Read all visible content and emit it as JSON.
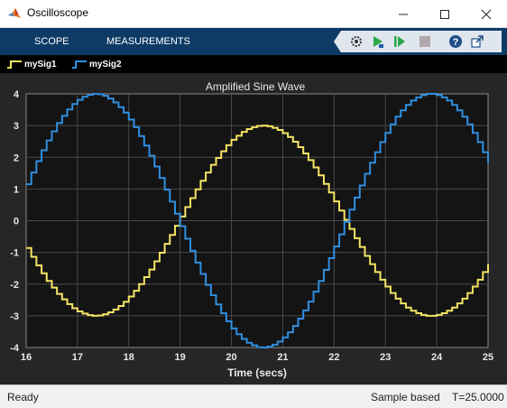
{
  "window": {
    "title": "Oscilloscope"
  },
  "toolstrip": {
    "tabs": [
      {
        "label": "SCOPE"
      },
      {
        "label": "MEASUREMENTS"
      }
    ],
    "icons": [
      "settings-icon",
      "step-forward-icon",
      "run-icon",
      "stop-icon",
      "help-icon",
      "undock-icon"
    ]
  },
  "legend": [
    {
      "label": "mySig1",
      "color": "#f5e463"
    },
    {
      "label": "mySig2",
      "color": "#2f8fe0"
    }
  ],
  "status": {
    "left": "Ready",
    "mode": "Sample based",
    "time": "T=25.0000"
  },
  "chart_data": {
    "type": "line",
    "title": "Amplified Sine Wave",
    "xlabel": "Time (secs)",
    "ylabel": "",
    "xlim": [
      16,
      25
    ],
    "ylim": [
      -4,
      4
    ],
    "xticks": [
      16,
      17,
      18,
      19,
      20,
      21,
      22,
      23,
      24,
      25
    ],
    "yticks": [
      4,
      3,
      2,
      1,
      0,
      -1,
      -2,
      -3,
      -4
    ],
    "grid": true,
    "legend_position": "top-left",
    "step": 0.1,
    "series": [
      {
        "name": "mySig1",
        "color": "#f5e463",
        "x": [
          16.0,
          16.1,
          16.2,
          16.3,
          16.4,
          16.5,
          16.6,
          16.7,
          16.8,
          16.9,
          17.0,
          17.1,
          17.2,
          17.3,
          17.4,
          17.5,
          17.6,
          17.7,
          17.8,
          17.9,
          18.0,
          18.1,
          18.2,
          18.3,
          18.4,
          18.5,
          18.6,
          18.7,
          18.8,
          18.9,
          19.0,
          19.1,
          19.2,
          19.3,
          19.4,
          19.5,
          19.6,
          19.7,
          19.8,
          19.9,
          20.0,
          20.1,
          20.2,
          20.3,
          20.4,
          20.5,
          20.6,
          20.7,
          20.8,
          20.9,
          21.0,
          21.1,
          21.2,
          21.3,
          21.4,
          21.5,
          21.6,
          21.7,
          21.8,
          21.9,
          22.0,
          22.1,
          22.2,
          22.3,
          22.4,
          22.5,
          22.6,
          22.7,
          22.8,
          22.9,
          23.0,
          23.1,
          23.2,
          23.3,
          23.4,
          23.5,
          23.6,
          23.7,
          23.8,
          23.9,
          24.0,
          24.1,
          24.2,
          24.3,
          24.4,
          24.5,
          24.6,
          24.7,
          24.8,
          24.9,
          25.0
        ],
        "y": [
          -0.86,
          -1.14,
          -1.41,
          -1.66,
          -1.9,
          -2.11,
          -2.31,
          -2.48,
          -2.63,
          -2.76,
          -2.86,
          -2.93,
          -2.98,
          -3.0,
          -2.99,
          -2.95,
          -2.89,
          -2.8,
          -2.69,
          -2.56,
          -2.39,
          -2.21,
          -2.0,
          -1.78,
          -1.54,
          -1.28,
          -1.01,
          -0.73,
          -0.45,
          -0.16,
          0.13,
          0.43,
          0.71,
          0.99,
          1.26,
          1.52,
          1.76,
          1.98,
          2.19,
          2.38,
          2.55,
          2.68,
          2.8,
          2.89,
          2.95,
          2.99,
          3.0,
          2.98,
          2.93,
          2.86,
          2.76,
          2.64,
          2.49,
          2.32,
          2.12,
          1.91,
          1.68,
          1.43,
          1.16,
          0.89,
          0.61,
          0.32,
          0.03,
          -0.26,
          -0.55,
          -0.83,
          -1.11,
          -1.37,
          -1.62,
          -1.86,
          -2.08,
          -2.28,
          -2.46,
          -2.61,
          -2.74,
          -2.84,
          -2.92,
          -2.97,
          -3.0,
          -3.0,
          -2.97,
          -2.92,
          -2.84,
          -2.74,
          -2.61,
          -2.46,
          -2.28,
          -2.08,
          -1.86,
          -1.62,
          -1.37
        ]
      },
      {
        "name": "mySig2",
        "color": "#2f8fe0",
        "x": [
          16.0,
          16.1,
          16.2,
          16.3,
          16.4,
          16.5,
          16.6,
          16.7,
          16.8,
          16.9,
          17.0,
          17.1,
          17.2,
          17.3,
          17.4,
          17.5,
          17.6,
          17.7,
          17.8,
          17.9,
          18.0,
          18.1,
          18.2,
          18.3,
          18.4,
          18.5,
          18.6,
          18.7,
          18.8,
          18.9,
          19.0,
          19.1,
          19.2,
          19.3,
          19.4,
          19.5,
          19.6,
          19.7,
          19.8,
          19.9,
          20.0,
          20.1,
          20.2,
          20.3,
          20.4,
          20.5,
          20.6,
          20.7,
          20.8,
          20.9,
          21.0,
          21.1,
          21.2,
          21.3,
          21.4,
          21.5,
          21.6,
          21.7,
          21.8,
          21.9,
          22.0,
          22.1,
          22.2,
          22.3,
          22.4,
          22.5,
          22.6,
          22.7,
          22.8,
          22.9,
          23.0,
          23.1,
          23.2,
          23.3,
          23.4,
          23.5,
          23.6,
          23.7,
          23.8,
          23.9,
          24.0,
          24.1,
          24.2,
          24.3,
          24.4,
          24.5,
          24.6,
          24.7,
          24.8,
          24.9,
          25.0
        ],
        "y": [
          1.15,
          1.52,
          1.88,
          2.22,
          2.53,
          2.82,
          3.08,
          3.31,
          3.51,
          3.68,
          3.81,
          3.91,
          3.97,
          4.0,
          3.99,
          3.94,
          3.85,
          3.73,
          3.58,
          3.41,
          3.19,
          2.95,
          2.67,
          2.37,
          2.05,
          1.71,
          1.35,
          0.98,
          0.6,
          0.22,
          -0.17,
          -0.57,
          -0.95,
          -1.32,
          -1.68,
          -2.03,
          -2.35,
          -2.64,
          -2.92,
          -3.17,
          -3.4,
          -3.58,
          -3.73,
          -3.85,
          -3.93,
          -3.99,
          -4.0,
          -3.97,
          -3.91,
          -3.81,
          -3.68,
          -3.52,
          -3.32,
          -3.09,
          -2.83,
          -2.55,
          -2.24,
          -1.9,
          -1.55,
          -1.18,
          -0.81,
          -0.43,
          -0.04,
          0.35,
          0.73,
          1.11,
          1.48,
          1.83,
          2.16,
          2.48,
          2.77,
          3.04,
          3.28,
          3.48,
          3.65,
          3.79,
          3.89,
          3.96,
          4.0,
          4.0,
          3.96,
          3.89,
          3.79,
          3.65,
          3.48,
          3.28,
          3.04,
          2.77,
          2.48,
          2.16,
          1.83
        ]
      }
    ]
  }
}
